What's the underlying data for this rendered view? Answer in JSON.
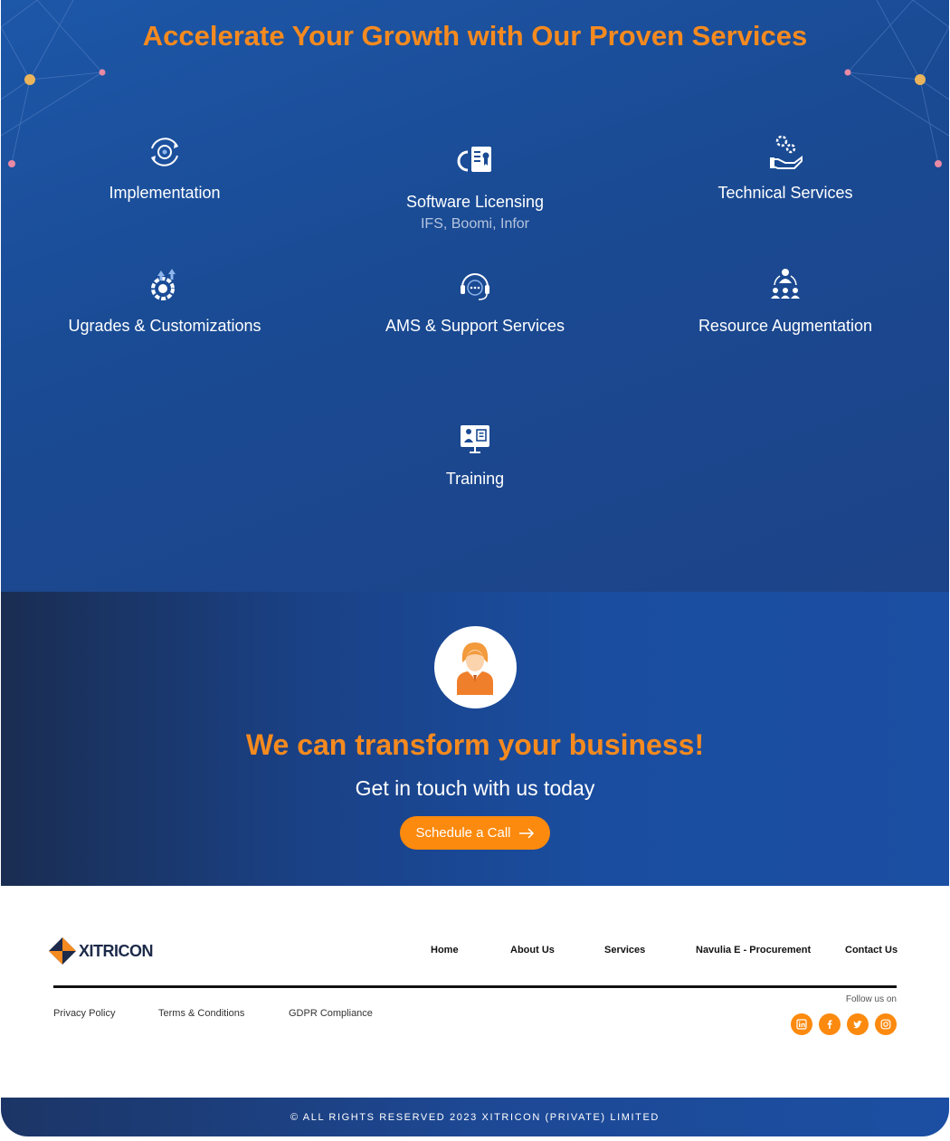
{
  "services": {
    "title": "Accelerate Your Growth with Our Proven Services",
    "items": [
      {
        "label": "Implementation",
        "icon": "gear-cycle-icon"
      },
      {
        "label": "Software Licensing",
        "sub": "IFS, Boomi, Infor",
        "icon": "license-document-icon"
      },
      {
        "label": "Technical Services",
        "icon": "gears-hand-icon"
      },
      {
        "label": "Ugrades & Customizations",
        "icon": "gear-upgrade-icon"
      },
      {
        "label": "AMS & Support Services",
        "icon": "headset-icon"
      },
      {
        "label": "Resource Augmentation",
        "icon": "team-network-icon"
      },
      {
        "label": "Training",
        "icon": "training-board-icon"
      }
    ]
  },
  "cta": {
    "title": "We can transform your business!",
    "subtitle": "Get in touch with us today",
    "button_label": "Schedule a Call",
    "avatar_icon": "support-agent-icon"
  },
  "footer": {
    "logo_text": "XITRICON",
    "nav": [
      "Home",
      "About Us",
      "Services",
      "Navulia E - Procurement",
      "Contact Us"
    ],
    "legal": [
      "Privacy Policy",
      "Terms & Conditions",
      "GDPR Compliance"
    ],
    "follow_label": "Follow us on",
    "socials": [
      "linkedin-icon",
      "facebook-icon",
      "twitter-icon",
      "instagram-icon"
    ],
    "copyright": "© ALL RIGHTS RESERVED 2023 XITRICON (PRIVATE) LIMITED"
  },
  "colors": {
    "accent": "#f58a1f",
    "button": "#fc8a0e",
    "navy": "#1a4a93",
    "white": "#ffffff"
  }
}
